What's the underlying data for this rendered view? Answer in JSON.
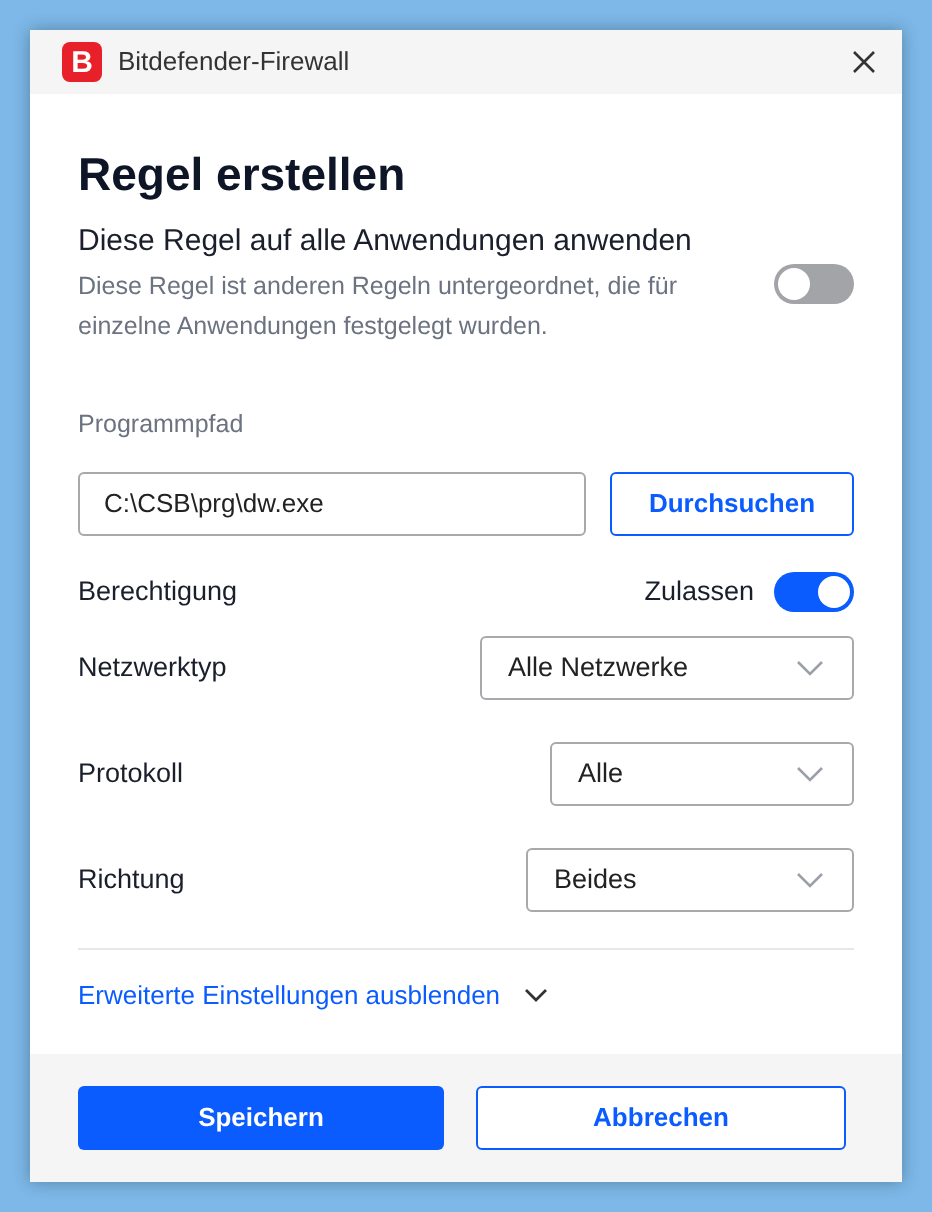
{
  "window": {
    "logo_letter": "B",
    "title": "Bitdefender-Firewall"
  },
  "heading": "Regel erstellen",
  "apply_all": {
    "label": "Diese Regel auf alle Anwendungen anwenden",
    "description": "Diese Regel ist anderen Regeln untergeordnet, die für einzelne Anwendungen festgelegt wurden.",
    "on": false
  },
  "program_path": {
    "label": "Programmpfad",
    "value": "C:\\CSB\\prg\\dw.exe",
    "browse_button": "Durchsuchen"
  },
  "permission": {
    "label": "Berechtigung",
    "state_label": "Zulassen",
    "on": true
  },
  "dropdowns": [
    {
      "label": "Netzwerktyp",
      "value": "Alle Netzwerke"
    },
    {
      "label": "Protokoll",
      "value": "Alle"
    },
    {
      "label": "Richtung",
      "value": "Beides"
    }
  ],
  "advanced_link": "Erweiterte Einstellungen ausblenden",
  "buttons": [
    {
      "label": "Speichern",
      "kind": "primary"
    },
    {
      "label": "Abbrechen",
      "kind": "secondary"
    }
  ]
}
